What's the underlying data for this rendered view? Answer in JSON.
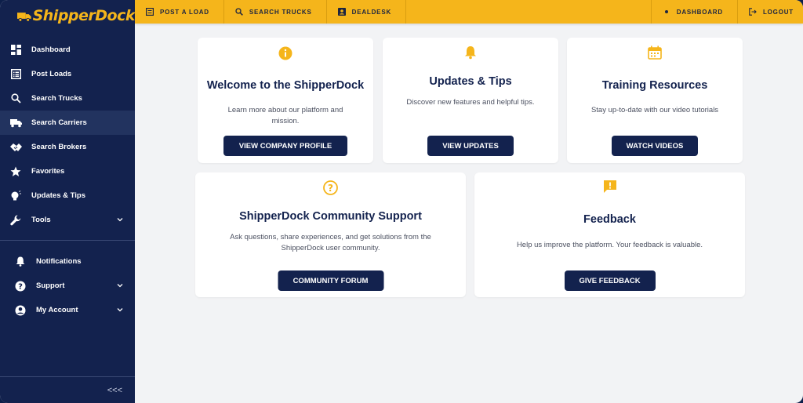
{
  "brand": {
    "name": "ShipperDock",
    "color": "#f5b51b"
  },
  "sidebar": {
    "items": [
      {
        "label": "Dashboard",
        "icon": "dashboard-grid-icon"
      },
      {
        "label": "Post Loads",
        "icon": "list-document-icon"
      },
      {
        "label": "Search Trucks",
        "icon": "search-icon"
      },
      {
        "label": "Search Carriers",
        "icon": "truck-icon",
        "active": true
      },
      {
        "label": "Search Brokers",
        "icon": "handshake-icon"
      },
      {
        "label": "Favorites",
        "icon": "star-icon"
      },
      {
        "label": "Updates & Tips",
        "icon": "lightbulb-icon"
      },
      {
        "label": "Tools",
        "icon": "wrench-icon",
        "expandable": true
      }
    ],
    "secondary": [
      {
        "label": "Notifications",
        "icon": "bell-icon"
      },
      {
        "label": "Support",
        "icon": "help-circle-icon",
        "expandable": true
      },
      {
        "label": "My Account",
        "icon": "account-circle-icon",
        "expandable": true
      }
    ],
    "collapse_label": "<<<"
  },
  "topbar": {
    "post_load": "POST A LOAD",
    "search_trucks": "SEARCH TRUCKS",
    "dealdesk": "DEALDESK",
    "dashboard": "DASHBOARD",
    "logout": "LOGOUT"
  },
  "cards": {
    "welcome": {
      "title": "Welcome to the ShipperDock",
      "text": "Learn more about our platform and mission.",
      "button": "VIEW COMPANY PROFILE"
    },
    "updates": {
      "title": "Updates & Tips",
      "text": "Discover new features and helpful tips.",
      "button": "VIEW UPDATES"
    },
    "training": {
      "title": "Training Resources",
      "text": "Stay up-to-date with our video tutorials",
      "button": "WATCH VIDEOS"
    },
    "community": {
      "title": "ShipperDock Community Support",
      "text": "Ask questions, share experiences, and get solutions from the ShipperDock user community.",
      "button": "COMMUNITY FORUM"
    },
    "feedback": {
      "title": "Feedback",
      "text": "Help us improve the platform. Your feedback is valuable.",
      "button": "GIVE FEEDBACK"
    }
  },
  "colors": {
    "navy": "#13224e",
    "accent": "#f5b51b",
    "background": "#f2f3f5"
  }
}
